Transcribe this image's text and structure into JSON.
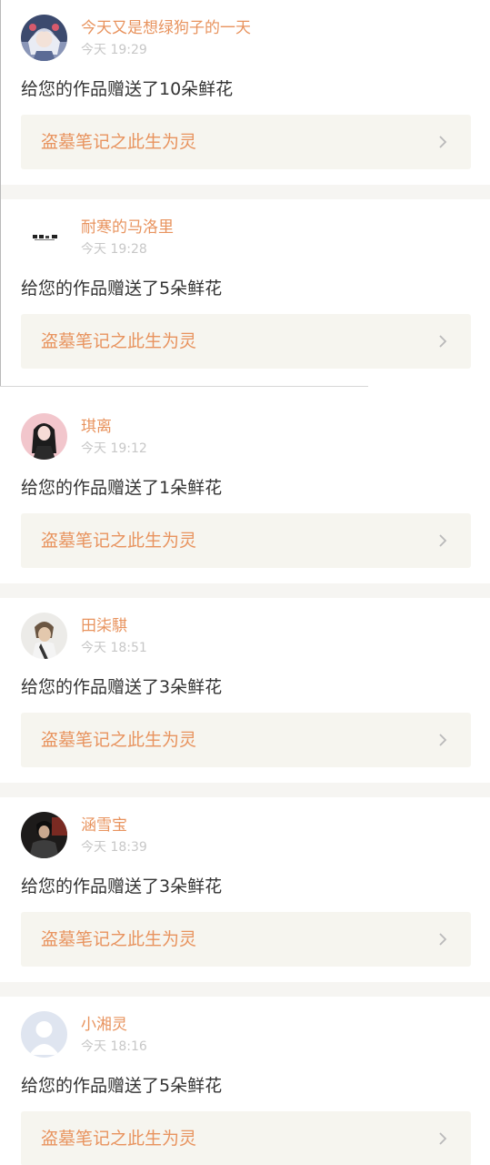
{
  "colors": {
    "name": "#e8935e",
    "time": "#c7c7c7",
    "message": "#333333",
    "link_bg": "#f6f5ef",
    "separator": "#f6f5f2",
    "chevron": "#b9b9b9"
  },
  "notifications": [
    {
      "username": "今天又是想绿狗子的一天",
      "time": "今天 19:29",
      "message": "给您的作品赠送了10朵鲜花",
      "work_title": "盗墓笔记之此生为灵",
      "avatar": "anime-girl-avatar"
    },
    {
      "username": "耐寒的马洛里",
      "time": "今天 19:28",
      "message": "给您的作品赠送了5朵鲜花",
      "work_title": "盗墓笔记之此生为灵",
      "avatar": "text-logo-avatar"
    },
    {
      "username": "琪离",
      "time": "今天 19:12",
      "message": "给您的作品赠送了1朵鲜花",
      "work_title": "盗墓笔记之此生为灵",
      "avatar": "pink-girl-avatar"
    },
    {
      "username": "田柒騏",
      "time": "今天 18:51",
      "message": "给您的作品赠送了3朵鲜花",
      "work_title": "盗墓笔记之此生为灵",
      "avatar": "portrait-avatar"
    },
    {
      "username": "涵雪宝",
      "time": "今天 18:39",
      "message": "给您的作品赠送了3朵鲜花",
      "work_title": "盗墓笔记之此生为灵",
      "avatar": "dark-portrait-avatar"
    },
    {
      "username": "小湘灵",
      "time": "今天 18:16",
      "message": "给您的作品赠送了5朵鲜花",
      "work_title": "盗墓笔记之此生为灵",
      "avatar": "default-user-avatar"
    }
  ]
}
